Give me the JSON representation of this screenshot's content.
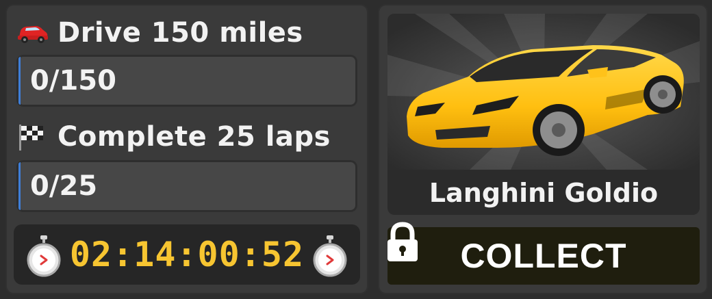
{
  "tasks": [
    {
      "icon": "car-icon",
      "title": "Drive 150 miles",
      "progress_text": "0/150",
      "progress": 0.0
    },
    {
      "icon": "checkered-flag-icon",
      "title": "Complete 25 laps",
      "progress_text": "0/25",
      "progress": 0.0
    }
  ],
  "timer": {
    "value": "02:14:00:52",
    "icon": "stopwatch-icon"
  },
  "reward": {
    "name": "Langhini Goldio",
    "image": "yellow-sports-car",
    "collect_label": "COLLECT",
    "locked": true,
    "lock_icon": "padlock-icon"
  },
  "colors": {
    "timer": "#f7c531",
    "progress_accent": "#3f7fd9",
    "car_body": "#ffc21a"
  }
}
